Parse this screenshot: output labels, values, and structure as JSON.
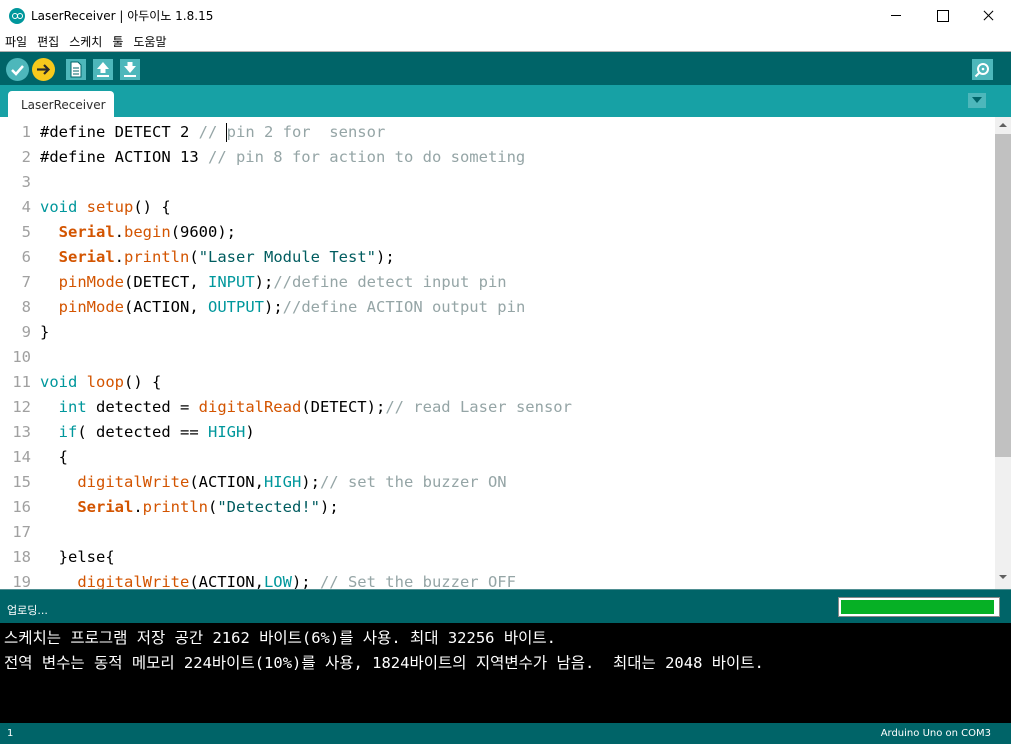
{
  "window": {
    "title": "LaserReceiver | 아두이노 1.8.15"
  },
  "menu": [
    "파일",
    "편집",
    "스케치",
    "툴",
    "도움말"
  ],
  "toolbar": {
    "verify_icon": "check-icon",
    "upload_icon": "arrow-right-icon",
    "new_icon": "new-file-icon",
    "open_icon": "arrow-up-icon",
    "save_icon": "arrow-down-icon",
    "serial_monitor_icon": "magnifier-icon"
  },
  "tabs": [
    {
      "label": "LaserReceiver"
    }
  ],
  "editor": {
    "lines": [
      {
        "n": "1",
        "tokens": [
          [
            "pp",
            "#define"
          ],
          [
            "",
            " DETECT 2 "
          ],
          [
            "cmt",
            "// pin 2 for  sensor"
          ]
        ]
      },
      {
        "n": "2",
        "tokens": [
          [
            "pp",
            "#define"
          ],
          [
            "",
            " ACTION 13 "
          ],
          [
            "cmt",
            "// pin 8 for action to do someting"
          ]
        ]
      },
      {
        "n": "3",
        "tokens": []
      },
      {
        "n": "4",
        "tokens": [
          [
            "kw",
            "void"
          ],
          [
            "",
            " "
          ],
          [
            "fn2",
            "setup"
          ],
          [
            "",
            "() {"
          ]
        ]
      },
      {
        "n": "5",
        "tokens": [
          [
            "",
            "  "
          ],
          [
            "cls",
            "Serial"
          ],
          [
            "",
            "."
          ],
          [
            "fn",
            "begin"
          ],
          [
            "",
            "(9600);"
          ]
        ]
      },
      {
        "n": "6",
        "tokens": [
          [
            "",
            "  "
          ],
          [
            "cls",
            "Serial"
          ],
          [
            "",
            "."
          ],
          [
            "fn",
            "println"
          ],
          [
            "",
            "("
          ],
          [
            "str",
            "\"Laser Module Test\""
          ],
          [
            "",
            ");"
          ]
        ]
      },
      {
        "n": "7",
        "tokens": [
          [
            "",
            "  "
          ],
          [
            "fn",
            "pinMode"
          ],
          [
            "",
            "(DETECT, "
          ],
          [
            "const",
            "INPUT"
          ],
          [
            "",
            ");"
          ],
          [
            "cmt",
            "//define detect input pin"
          ]
        ]
      },
      {
        "n": "8",
        "tokens": [
          [
            "",
            "  "
          ],
          [
            "fn",
            "pinMode"
          ],
          [
            "",
            "(ACTION, "
          ],
          [
            "const",
            "OUTPUT"
          ],
          [
            "",
            ");"
          ],
          [
            "cmt",
            "//define ACTION output pin"
          ]
        ]
      },
      {
        "n": "9",
        "tokens": [
          [
            "",
            "}"
          ]
        ]
      },
      {
        "n": "10",
        "tokens": []
      },
      {
        "n": "11",
        "tokens": [
          [
            "kw",
            "void"
          ],
          [
            "",
            " "
          ],
          [
            "fn2",
            "loop"
          ],
          [
            "",
            "() {"
          ]
        ]
      },
      {
        "n": "12",
        "tokens": [
          [
            "",
            "  "
          ],
          [
            "kw",
            "int"
          ],
          [
            "",
            " detected = "
          ],
          [
            "fn",
            "digitalRead"
          ],
          [
            "",
            "(DETECT);"
          ],
          [
            "cmt",
            "// read Laser sensor"
          ]
        ]
      },
      {
        "n": "13",
        "tokens": [
          [
            "",
            "  "
          ],
          [
            "kw",
            "if"
          ],
          [
            "",
            "( detected == "
          ],
          [
            "const",
            "HIGH"
          ],
          [
            "",
            ")"
          ]
        ]
      },
      {
        "n": "14",
        "tokens": [
          [
            "",
            "  {"
          ]
        ]
      },
      {
        "n": "15",
        "tokens": [
          [
            "",
            "    "
          ],
          [
            "fn",
            "digitalWrite"
          ],
          [
            "",
            "(ACTION,"
          ],
          [
            "const",
            "HIGH"
          ],
          [
            "",
            ");"
          ],
          [
            "cmt",
            "// set the buzzer ON"
          ]
        ]
      },
      {
        "n": "16",
        "tokens": [
          [
            "",
            "    "
          ],
          [
            "cls",
            "Serial"
          ],
          [
            "",
            "."
          ],
          [
            "fn",
            "println"
          ],
          [
            "",
            "("
          ],
          [
            "str",
            "\"Detected!\""
          ],
          [
            "",
            ");"
          ]
        ]
      },
      {
        "n": "17",
        "tokens": []
      },
      {
        "n": "18",
        "tokens": [
          [
            "",
            "  }else{"
          ]
        ]
      },
      {
        "n": "19",
        "tokens": [
          [
            "",
            "    "
          ],
          [
            "fn",
            "digitalWrite"
          ],
          [
            "",
            "(ACTION,"
          ],
          [
            "const",
            "LOW"
          ],
          [
            "",
            "); "
          ],
          [
            "cmt",
            "// Set the buzzer OFF"
          ]
        ]
      }
    ]
  },
  "status": {
    "message": "업로딩...",
    "progress_fraction": 0.98
  },
  "console": {
    "lines": [
      "스케치는 프로그램 저장 공간 2162 바이트(6%)를 사용. 최대 32256 바이트.",
      "전역 변수는 동적 메모리 224바이트(10%)를 사용, 1824바이트의 지역변수가 남음.  최대는 2048 바이트."
    ]
  },
  "footer": {
    "line": "1",
    "board": "Arduino Uno on COM3"
  },
  "colors": {
    "toolbar_bg": "#006468",
    "tab_strip_bg": "#17a1a5",
    "keyword": "#00979c",
    "function": "#d35400",
    "comment": "#95a5a6",
    "string": "#005c5f",
    "progress_fill": "#06b025"
  }
}
